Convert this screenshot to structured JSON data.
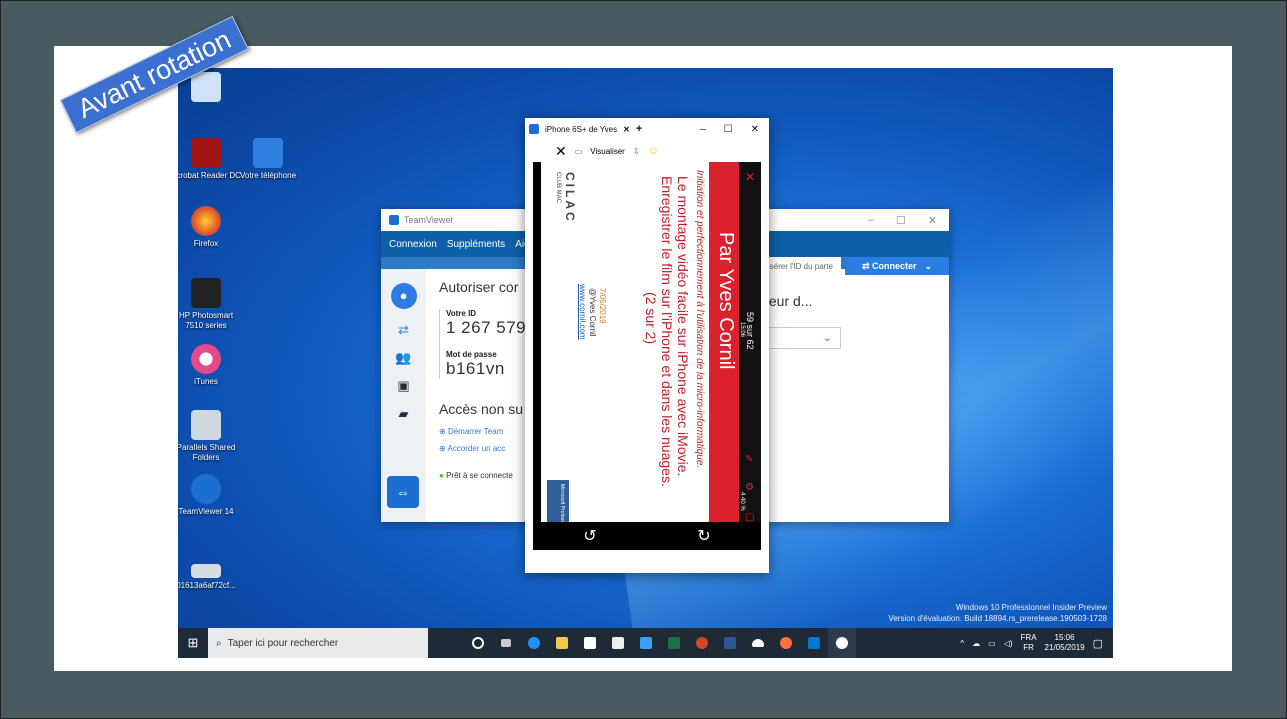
{
  "banner": {
    "label": "Avant rotation"
  },
  "desktop_icons": [
    {
      "label": "",
      "icon": "recycle-bin-icon"
    },
    {
      "label": "Acrobat Reader DC",
      "icon": "acrobat-icon"
    },
    {
      "label": "Votre téléphone",
      "icon": "phone-icon"
    },
    {
      "label": "Firefox",
      "icon": "firefox-icon"
    },
    {
      "label": "HP Photosmart 7510 series",
      "icon": "printer-icon"
    },
    {
      "label": "iTunes",
      "icon": "itunes-icon"
    },
    {
      "label": "Parallels Shared Folders",
      "icon": "folder-icon"
    },
    {
      "label": "TeamViewer 14",
      "icon": "teamviewer-icon"
    },
    {
      "label": "01613a6af72cf...",
      "icon": "file-icon"
    }
  ],
  "teamviewer": {
    "title": "TeamViewer",
    "menu": [
      "Connexion",
      "Suppléments",
      "Aid"
    ],
    "partner_id_placeholder": "Insérer l'ID du parte",
    "connect_label": "Connecter",
    "strip_text": "ornil",
    "remote_heading": "teur d...",
    "allow_heading": "Autoriser cor",
    "your_id_label": "Votre ID",
    "your_id_value": "1 267 579",
    "password_label": "Mot de passe",
    "password_value": "b161vn",
    "unattended_heading": "Accès non su",
    "start_link": "Démarrer Team",
    "grant_link": "Accorder un acc",
    "status": "Prêt à se connecte"
  },
  "iphone_window": {
    "tab_title": "iPhone 6S+ de Yves",
    "view_label": "Visualiser",
    "slide_line1": "Initiation et perfectionnement à l'utilisation de la micro-informatique.",
    "slide_line2": "Le montage vidéo facile sur iPhone avec iMovie.",
    "slide_line3": "Enregistrer le film sur l'iPhone et dans les nuages.",
    "slide_line4": "(2 sur 2)",
    "date": "7/05/2019",
    "author": "@Yves Cornil",
    "site": "www.cornil.com",
    "red_title": "Par Yves Cornil",
    "counter": "59 sur 62",
    "time": "15:06",
    "battery": "4 40 %",
    "logo": "CILAC",
    "logo_sub": "CLUB MAC",
    "badge": "Microsoft Professional"
  },
  "taskbar": {
    "search_placeholder": "Taper ici pour rechercher",
    "lang": "FRA",
    "lang_sub": "FR",
    "time": "15:06",
    "date": "21/05/2019"
  },
  "watermark": {
    "line1": "Windows 10 Professionnel Insider Preview",
    "line2": "Version d'évaluation. Build 18894.rs_prerelease.190503-1728"
  },
  "colors": {
    "accent": "#0e61a8",
    "connect": "#2a7de1",
    "red": "#d9222d"
  }
}
